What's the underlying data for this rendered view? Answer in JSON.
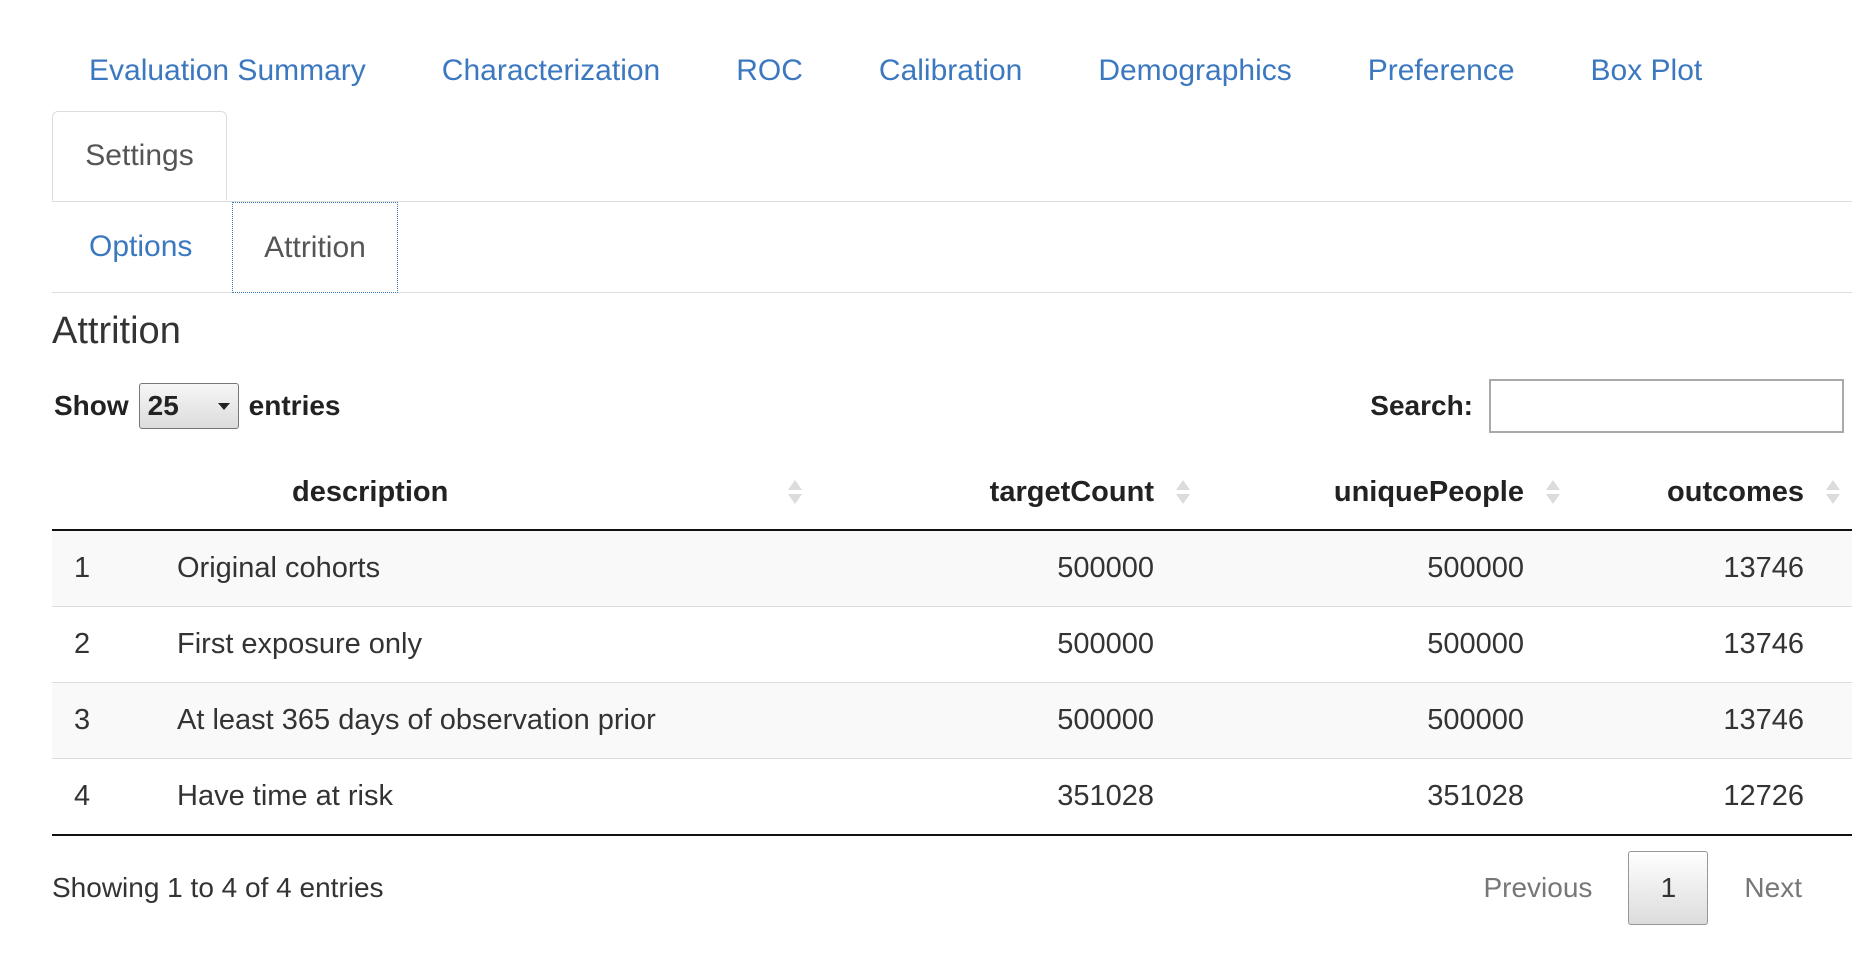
{
  "main_tabs": [
    {
      "label": "Evaluation Summary"
    },
    {
      "label": "Characterization"
    },
    {
      "label": "ROC"
    },
    {
      "label": "Calibration"
    },
    {
      "label": "Demographics"
    },
    {
      "label": "Preference"
    },
    {
      "label": "Box Plot"
    },
    {
      "label": "Settings",
      "active": true
    }
  ],
  "sub_tabs": [
    {
      "label": "Options"
    },
    {
      "label": "Attrition",
      "active": true
    }
  ],
  "section": {
    "title": "Attrition"
  },
  "length_control": {
    "prefix": "Show",
    "value": "25",
    "suffix": "entries"
  },
  "search": {
    "label": "Search:",
    "value": ""
  },
  "table": {
    "columns": [
      "",
      "description",
      "targetCount",
      "uniquePeople",
      "outcomes"
    ],
    "rows": [
      {
        "index": "1",
        "description": "Original cohorts",
        "targetCount": "500000",
        "uniquePeople": "500000",
        "outcomes": "13746"
      },
      {
        "index": "2",
        "description": "First exposure only",
        "targetCount": "500000",
        "uniquePeople": "500000",
        "outcomes": "13746"
      },
      {
        "index": "3",
        "description": "At least 365 days of observation prior",
        "targetCount": "500000",
        "uniquePeople": "500000",
        "outcomes": "13746"
      },
      {
        "index": "4",
        "description": "Have time at risk",
        "targetCount": "351028",
        "uniquePeople": "351028",
        "outcomes": "12726"
      }
    ]
  },
  "footer": {
    "info": "Showing 1 to 4 of 4 entries",
    "pagination": {
      "previous": "Previous",
      "current": "1",
      "next": "Next"
    }
  },
  "colors": {
    "link": "#3c78c0",
    "text": "#333333",
    "border": "#dddddd"
  }
}
